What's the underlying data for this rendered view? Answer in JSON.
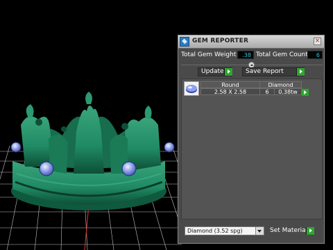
{
  "window": {
    "title": "GEM REPORTER",
    "close_glyph": "×"
  },
  "stats": {
    "total_weight_label": "Total Gem Weight",
    "total_weight_value": ".38",
    "total_count_label": "Total Gem Count",
    "total_count_value": "6"
  },
  "actions": {
    "update_label": "Update",
    "save_report_label": "Save Report"
  },
  "gem_list": {
    "rows": [
      {
        "shape": "Round",
        "material": "Diamond",
        "size": "2.58 X 2.58",
        "count": "6",
        "weight": "0.38tw"
      }
    ]
  },
  "footer": {
    "material_value": "Diamond    (3.52 spg)",
    "set_material_label": "Set Material"
  },
  "colors": {
    "crown_green": "#1f8a63",
    "grid_line": "#e8e8e8",
    "go_green": "#2fa52f",
    "value_text": "#27c7d8"
  },
  "icons": [
    "app-icon",
    "close-icon",
    "collapse-arrow-icon",
    "go-arrow-icon",
    "dropdown-arrow-icon",
    "round-gem-icon"
  ]
}
